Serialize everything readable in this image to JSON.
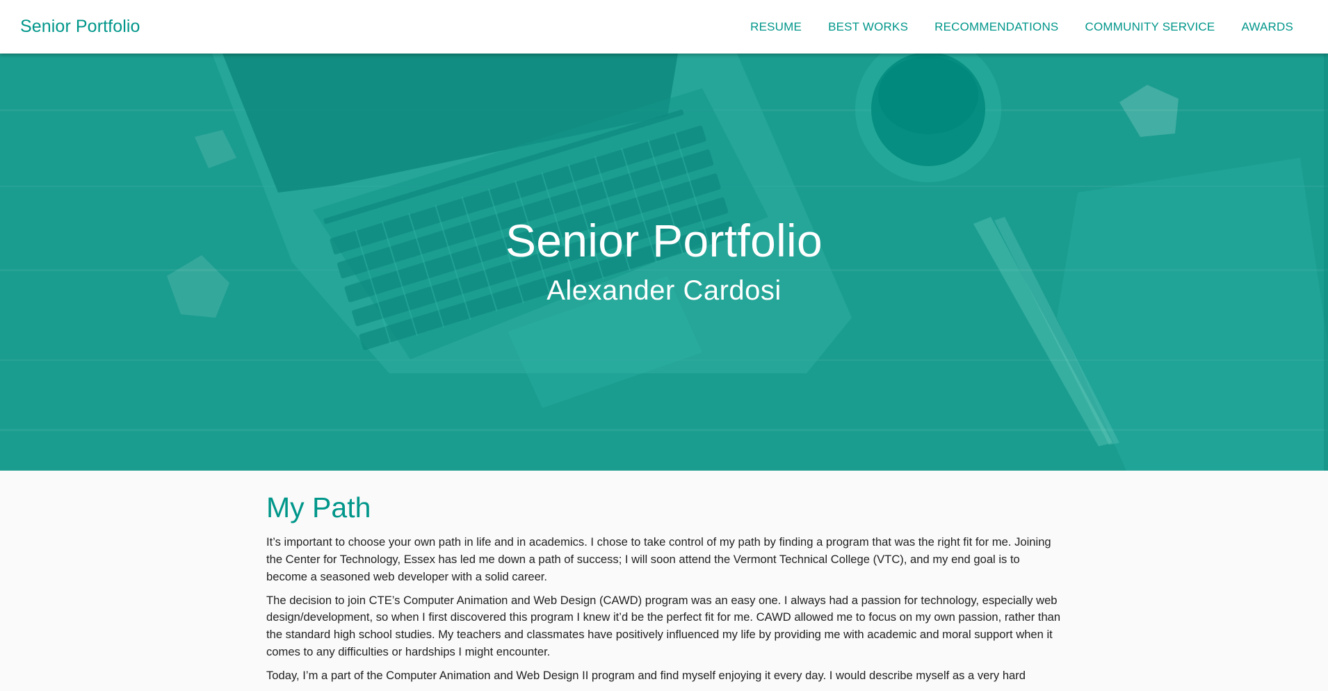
{
  "nav": {
    "brand": "Senior Portfolio",
    "links": [
      {
        "label": "RESUME"
      },
      {
        "label": "BEST WORKS"
      },
      {
        "label": "RECOMMENDATIONS"
      },
      {
        "label": "COMMUNITY SERVICE"
      },
      {
        "label": "AWARDS"
      }
    ]
  },
  "hero": {
    "title": "Senior Portfolio",
    "subtitle": "Alexander Cardosi"
  },
  "main": {
    "section_title": "My Path",
    "paragraphs": [
      "It’s important to choose your own path in life and in academics. I chose to take control of my path by finding a program that was the right fit for me. Joining the Center for Technology, Essex has led me down a path of success; I will soon attend the Vermont Technical College (VTC), and my end goal is to become a seasoned web developer with a solid career.",
      "The decision to join CTE’s Computer Animation and Web Design (CAWD) program was an easy one. I always had a passion for technology, especially web design/development, so when I first discovered this program I knew it’d be the perfect fit for me. CAWD allowed me to focus on my own passion, rather than the standard high school studies. My teachers and classmates have positively influenced my life by providing me with academic and moral support when it comes to any difficulties or hardships I might encounter.",
      "Today, I’m a part of the Computer Animation and Web Design II program and find myself enjoying it every day. I would describe myself as a very hard"
    ]
  },
  "colors": {
    "accent": "#00968a",
    "hero_overlay": "#1a9d8f",
    "page_background": "#fafafa",
    "body_text": "#212121"
  }
}
